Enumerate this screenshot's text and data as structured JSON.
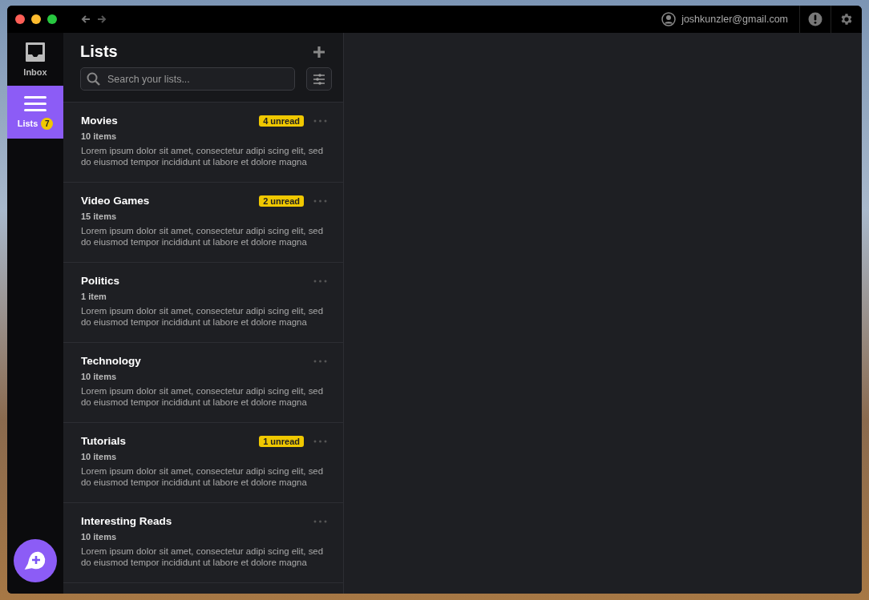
{
  "titlebar": {
    "account": "joshkunzler@gmail.com"
  },
  "nav": [
    {
      "kind": "inbox",
      "label": "Inbox",
      "selected": false
    },
    {
      "kind": "lists",
      "label": "Lists",
      "badge": "7",
      "selected": true
    }
  ],
  "panel": {
    "title": "Lists",
    "search": {
      "placeholder": "Search your lists..."
    }
  },
  "lists": [
    {
      "name": "Movies",
      "count": "10 items",
      "unread": "4 unread",
      "description": "Lorem ipsum dolor sit amet, consectetur adipi scing elit, sed do eiusmod tempor incididunt ut labore et dolore magna"
    },
    {
      "name": "Video Games",
      "count": "15 items",
      "unread": "2 unread",
      "description": "Lorem ipsum dolor sit amet, consectetur adipi scing elit, sed do eiusmod tempor incididunt ut labore et dolore magna"
    },
    {
      "name": "Politics",
      "count": "1 item",
      "description": "Lorem ipsum dolor sit amet, consectetur adipi scing elit, sed do eiusmod tempor incididunt ut labore et dolore magna"
    },
    {
      "name": "Technology",
      "count": "10 items",
      "description": "Lorem ipsum dolor sit amet, consectetur adipi scing elit, sed do eiusmod tempor incididunt ut labore et dolore magna"
    },
    {
      "name": "Tutorials",
      "count": "10 items",
      "unread": "1 unread",
      "description": "Lorem ipsum dolor sit amet, consectetur adipi scing elit, sed do eiusmod tempor incididunt ut labore et dolore magna"
    },
    {
      "name": "Interesting Reads",
      "count": "10 items",
      "description": "Lorem ipsum dolor sit amet, consectetur adipi scing elit, sed do eiusmod tempor incididunt ut labore et dolore magna"
    }
  ]
}
